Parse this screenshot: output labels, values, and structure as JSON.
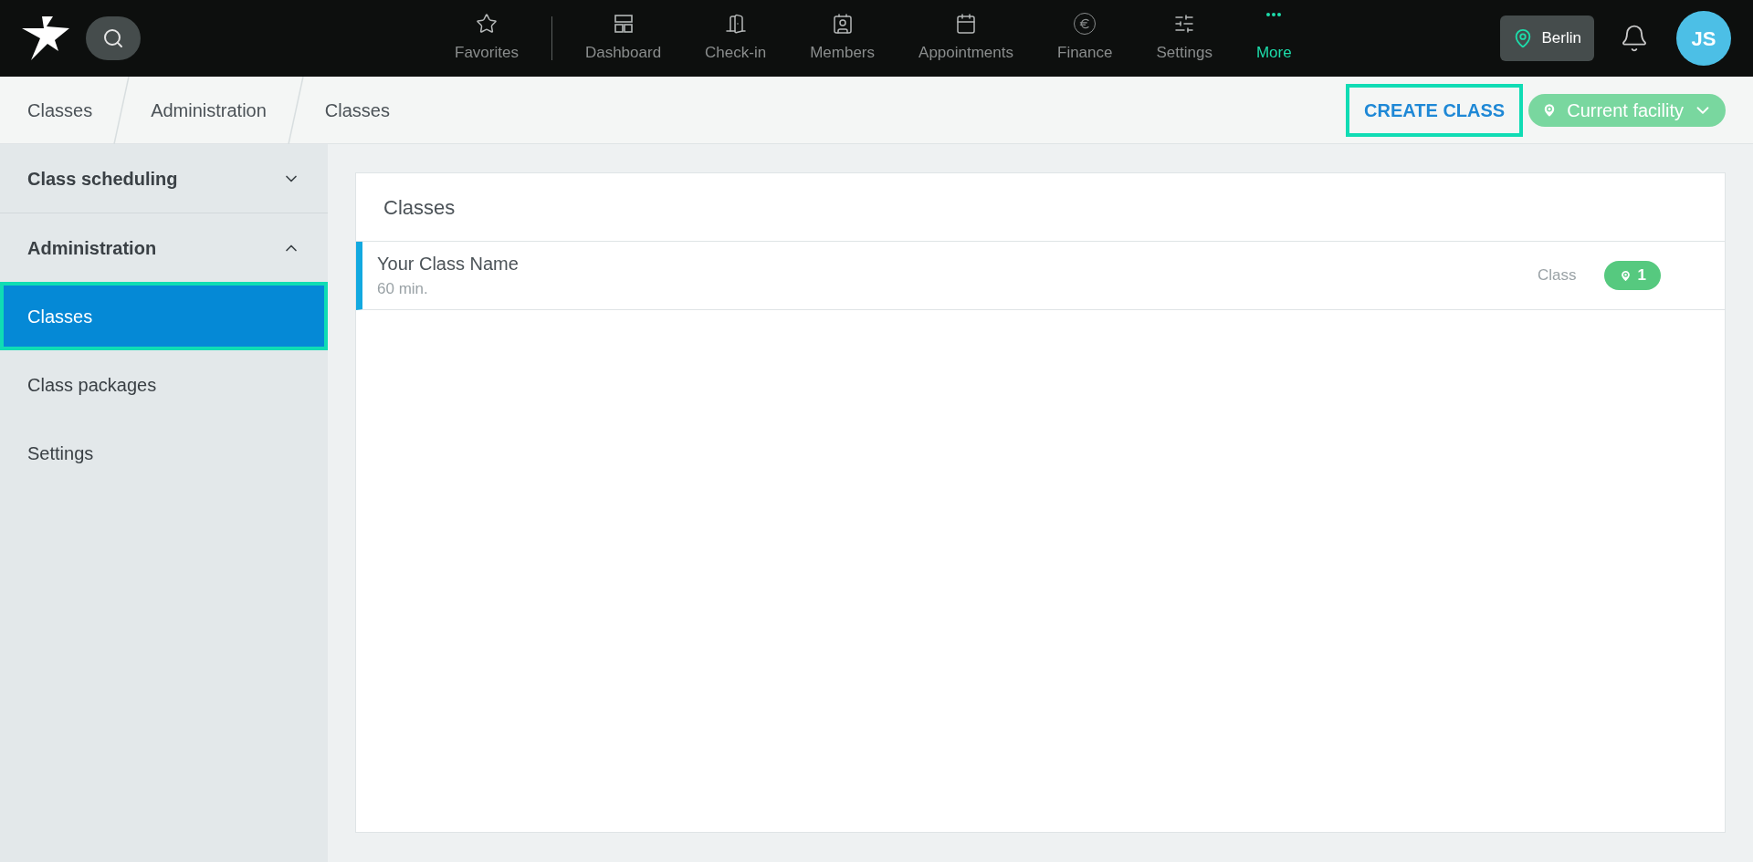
{
  "top_bar": {
    "nav": [
      {
        "label": "Favorites",
        "selected": false
      },
      {
        "label": "Dashboard",
        "selected": false
      },
      {
        "label": "Check-in",
        "selected": false
      },
      {
        "label": "Members",
        "selected": false
      },
      {
        "label": "Appointments",
        "selected": false
      },
      {
        "label": "Finance",
        "selected": false
      },
      {
        "label": "Settings",
        "selected": false
      },
      {
        "label": "More",
        "selected": true
      }
    ],
    "location": "Berlin",
    "avatar": "JS"
  },
  "breadcrumbs": [
    "Classes",
    "Administration",
    "Classes"
  ],
  "create_button": {
    "label": "CREATE CLASS",
    "highlighted": true
  },
  "facility_filter": "Current facility",
  "sidebar": [
    {
      "label": "Class scheduling",
      "expanded": false
    },
    {
      "label": "Administration",
      "expanded": true,
      "children": [
        {
          "label": "Classes",
          "selected": true,
          "highlighted": true
        },
        {
          "label": "Class packages",
          "selected": false,
          "highlighted": false
        },
        {
          "label": "Settings",
          "selected": false,
          "highlighted": false
        }
      ]
    }
  ],
  "panel": {
    "title": "Classes",
    "rows": [
      {
        "name": "Your Class Name",
        "duration": "60 min.",
        "type": "Class",
        "locations": "1"
      }
    ]
  }
}
